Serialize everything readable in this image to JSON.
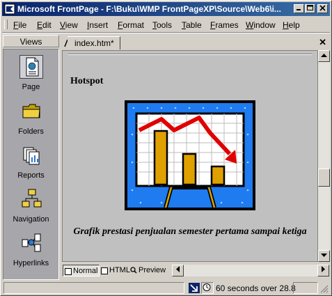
{
  "window": {
    "title": "Microsoft FrontPage - F:\\Buku\\WMP FrontPageXP\\Source\\Web6\\i..."
  },
  "menu": {
    "items": [
      {
        "label": "File",
        "ul": "F",
        "rest": "ile"
      },
      {
        "label": "Edit",
        "ul": "E",
        "rest": "dit"
      },
      {
        "label": "View",
        "ul": "V",
        "rest": "iew"
      },
      {
        "label": "Insert",
        "ul": "I",
        "rest": "nsert"
      },
      {
        "label": "Format",
        "ul": "F",
        "rest": "ormat"
      },
      {
        "label": "Tools",
        "ul": "T",
        "rest": "ools"
      },
      {
        "label": "Table",
        "ul": "T",
        "rest": "able"
      },
      {
        "label": "Frames",
        "ul": "F",
        "rest": "rames"
      },
      {
        "label": "Window",
        "ul": "W",
        "rest": "indow"
      },
      {
        "label": "Help",
        "ul": "H",
        "rest": "elp"
      }
    ]
  },
  "views": {
    "header": "Views",
    "items": [
      {
        "label": "Page",
        "icon": "page-view-icon",
        "selected": true
      },
      {
        "label": "Folders",
        "icon": "folder-icon"
      },
      {
        "label": "Reports",
        "icon": "reports-icon"
      },
      {
        "label": "Navigation",
        "icon": "navigation-icon"
      },
      {
        "label": "Hyperlinks",
        "icon": "hyperlinks-icon"
      }
    ]
  },
  "document": {
    "tab_label": "index.htm*",
    "close_glyph": "✕",
    "heading": "Hotspot",
    "caption": "Grafik prestasi penjualan semester pertama sampai ketiga"
  },
  "view_tabs": {
    "normal": "Normal",
    "html": "HTML",
    "preview": "Preview"
  },
  "status": {
    "download_time": "60 seconds over 28.8"
  },
  "colors": {
    "titlebar": "#0a246a",
    "chart_bg": "#1e7bf0",
    "chart_bar": "#e0a000",
    "chart_arrow": "#e00000"
  }
}
